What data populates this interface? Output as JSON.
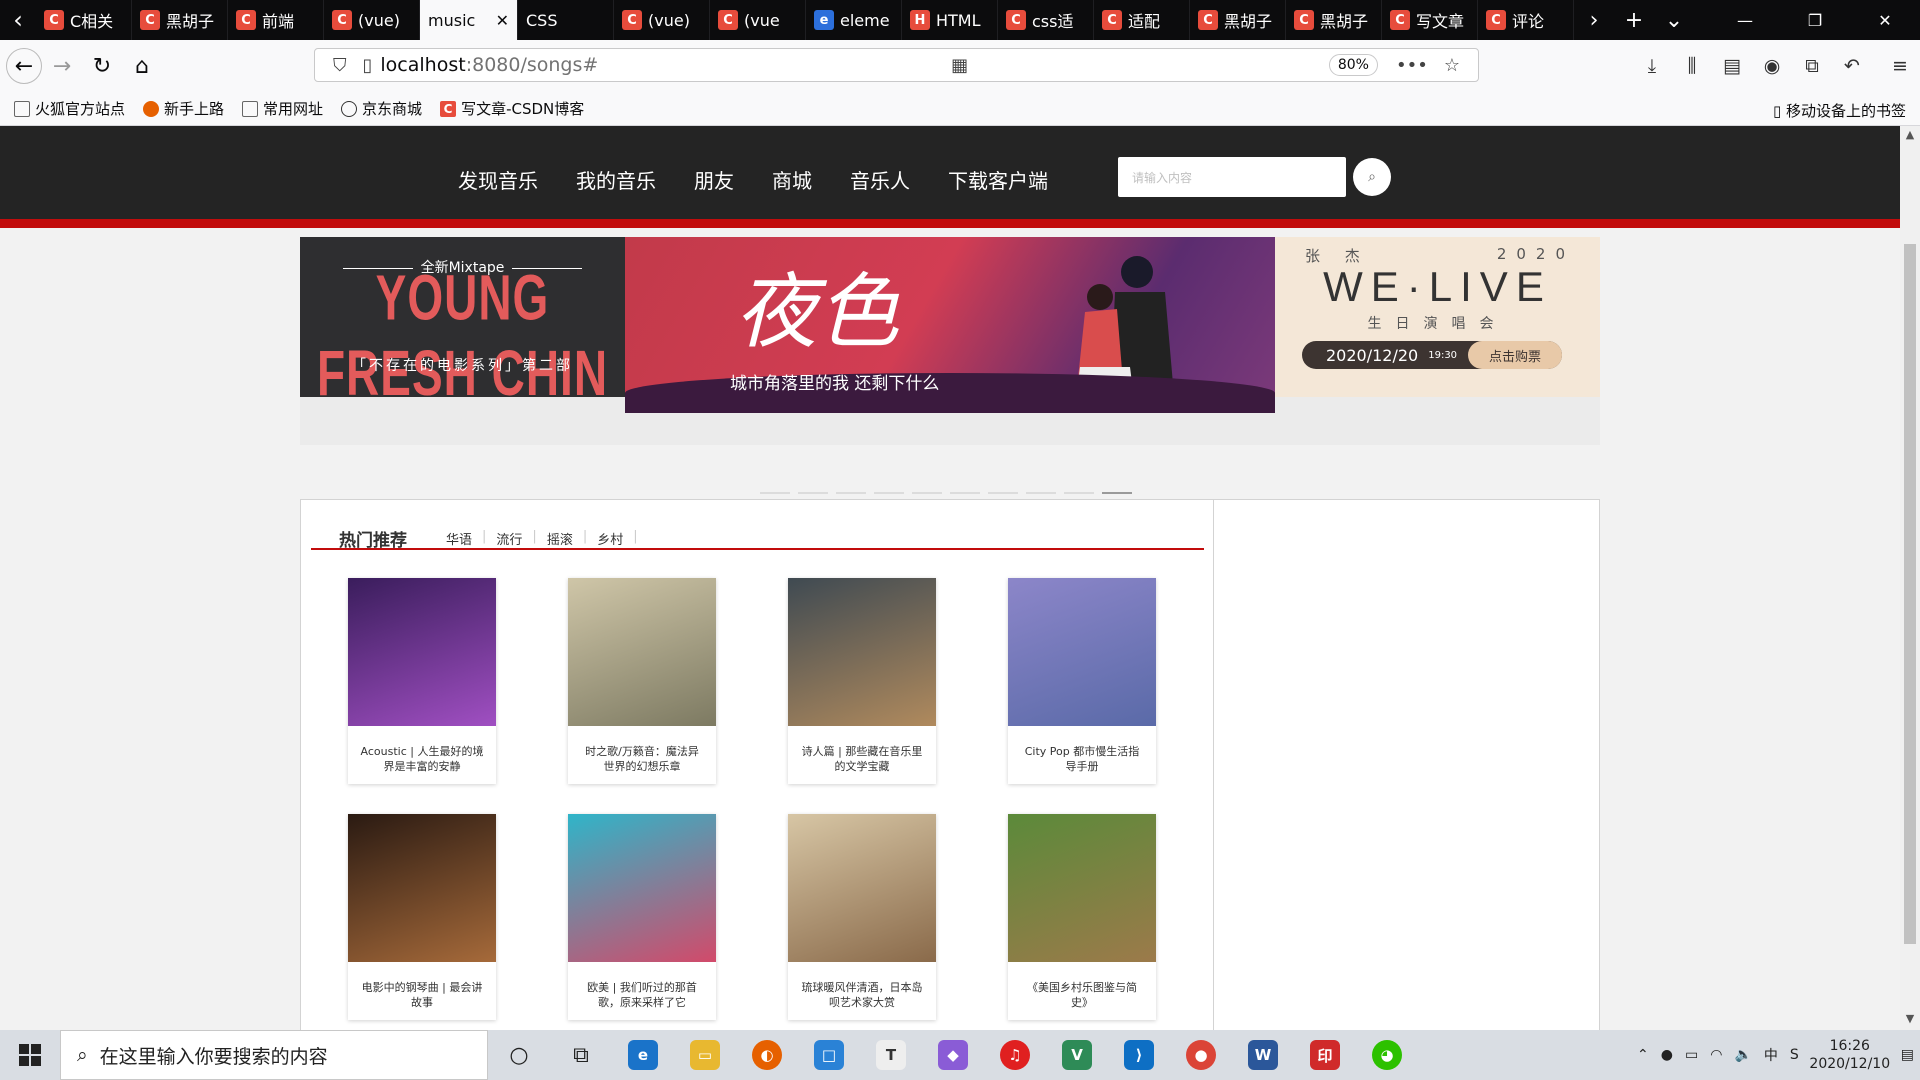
{
  "browser": {
    "tabs": [
      {
        "label": "C相关",
        "fav": "C"
      },
      {
        "label": "黑胡子",
        "fav": "C"
      },
      {
        "label": "前端",
        "fav": "C"
      },
      {
        "label": "(vue)",
        "fav": "C"
      },
      {
        "label": "music",
        "fav": "",
        "active": true
      },
      {
        "label": "CSS",
        "fav": ""
      },
      {
        "label": "(vue)",
        "fav": "C"
      },
      {
        "label": "(vue",
        "fav": "C"
      },
      {
        "label": "eleme",
        "fav": "e"
      },
      {
        "label": "HTML",
        "fav": "H"
      },
      {
        "label": "css适",
        "fav": "C"
      },
      {
        "label": "适配",
        "fav": "C"
      },
      {
        "label": "黑胡子",
        "fav": "C"
      },
      {
        "label": "黑胡子",
        "fav": "C"
      },
      {
        "label": "写文章",
        "fav": "C"
      },
      {
        "label": "评论",
        "fav": "C"
      }
    ],
    "url_host": "localhost",
    "url_path": ":8080/songs#",
    "zoom": "80%",
    "bookmarks": [
      "火狐官方站点",
      "新手上路",
      "常用网址",
      "京东商城",
      "写文章-CSDN博客"
    ],
    "mobile_bookmarks": "移动设备上的书签"
  },
  "site": {
    "nav": [
      "发现音乐",
      "我的音乐",
      "朋友",
      "商城",
      "音乐人",
      "下载客户端"
    ],
    "search_placeholder": "请输入内容",
    "banner": {
      "left_mix": "全新Mixtape",
      "left_big": "YOUNG FRESH CHIN",
      "left_sub": "「不存在的电影系列」第二部",
      "mid_calli": "夜色",
      "mid_caption": "城市角落里的我 还剩下什么",
      "right_artist": "张 杰",
      "right_year": "2020",
      "right_title": "WE·LIVE",
      "right_sub": "生日演唱会",
      "right_date": "2020/12/20",
      "right_time": "19:30",
      "right_buy": "点击购票"
    },
    "hot": {
      "title": "热门推荐",
      "tabs": [
        "华语",
        "流行",
        "摇滚",
        "乡村"
      ]
    },
    "playlists": [
      {
        "title": "Acoustic | 人生最好的境界是丰富的安静",
        "colors": [
          "#3a1d5c",
          "#a04fc2"
        ]
      },
      {
        "title": "时之歌/万籁音：魔法异世界的幻想乐章",
        "colors": [
          "#cfc6a8",
          "#7d7a62"
        ]
      },
      {
        "title": "诗人篇 | 那些藏在音乐里的文学宝藏",
        "colors": [
          "#3f4a52",
          "#b08a5d"
        ]
      },
      {
        "title": "City Pop 都市慢生活指导手册",
        "colors": [
          "#8c86c9",
          "#5a6aa8"
        ]
      },
      {
        "title": "电影中的钢琴曲 | 最会讲故事",
        "colors": [
          "#2a1a12",
          "#a66a3a"
        ]
      },
      {
        "title": "欧美 | 我们听过的那首歌，原来采样了它",
        "colors": [
          "#2fb5c9",
          "#d24a6a"
        ]
      },
      {
        "title": "琉球暖风伴清酒，日本岛呗艺术家大赏",
        "colors": [
          "#d7c6a5",
          "#8a6a4a"
        ]
      },
      {
        "title": "《美国乡村乐图鉴与简史》",
        "colors": [
          "#5b8a3a",
          "#9c7a4a"
        ]
      }
    ]
  },
  "taskbar": {
    "search": "在这里输入你要搜索的内容",
    "time": "16:26",
    "date": "2020/12/10",
    "ime": "中"
  },
  "colors": {
    "accent_red": "#c20c0c",
    "header_dark": "#242424"
  }
}
